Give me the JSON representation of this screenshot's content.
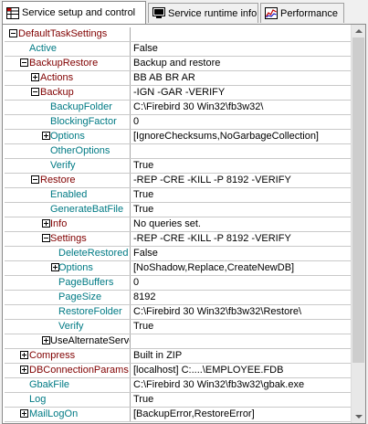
{
  "tabs": [
    {
      "label": "Service setup and control",
      "icon": "settings-grid-icon",
      "active": true
    },
    {
      "label": "Service runtime info",
      "icon": "monitor-icon",
      "active": false
    },
    {
      "label": "Performance",
      "icon": "chart-icon",
      "active": false
    }
  ],
  "rows": [
    {
      "name": "DefaultTaskSettings",
      "value": "",
      "level": 0,
      "expander": "minus",
      "color": "red"
    },
    {
      "name": "Active",
      "value": "False",
      "level": 1,
      "expander": "",
      "color": "teal"
    },
    {
      "name": "BackupRestore",
      "value": "Backup and restore",
      "level": 1,
      "expander": "minus",
      "color": "red"
    },
    {
      "name": "Actions",
      "value": "BB AB BR AR",
      "level": 2,
      "expander": "plus",
      "color": "red"
    },
    {
      "name": "Backup",
      "value": "-IGN -GAR -VERIFY",
      "level": 2,
      "expander": "minus",
      "color": "red"
    },
    {
      "name": "BackupFolder",
      "value": "C:\\Firebird 30 Win32\\fb3w32\\",
      "level": 3,
      "expander": "",
      "color": "teal"
    },
    {
      "name": "BlockingFactor",
      "value": "0",
      "level": 3,
      "expander": "",
      "color": "teal"
    },
    {
      "name": "Options",
      "value": "[IgnoreChecksums,NoGarbageCollection]",
      "level": 3,
      "expander": "plus",
      "color": "teal"
    },
    {
      "name": "OtherOptions",
      "value": "",
      "level": 3,
      "expander": "",
      "color": "teal"
    },
    {
      "name": "Verify",
      "value": "True",
      "level": 3,
      "expander": "",
      "color": "teal"
    },
    {
      "name": "Restore",
      "value": "-REP -CRE -KILL -P 8192 -VERIFY",
      "level": 2,
      "expander": "minus",
      "color": "red"
    },
    {
      "name": "Enabled",
      "value": "True",
      "level": 3,
      "expander": "",
      "color": "teal"
    },
    {
      "name": "GenerateBatFile",
      "value": "True",
      "level": 3,
      "expander": "",
      "color": "teal"
    },
    {
      "name": "Info",
      "value": "No queries set.",
      "level": 3,
      "expander": "plus",
      "color": "red"
    },
    {
      "name": "Settings",
      "value": "-REP -CRE -KILL -P 8192 -VERIFY",
      "level": 3,
      "expander": "minus",
      "color": "red"
    },
    {
      "name": "DeleteRestored",
      "value": "False",
      "level": 4,
      "expander": "",
      "color": "teal"
    },
    {
      "name": "Options",
      "value": "[NoShadow,Replace,CreateNewDB]",
      "level": 4,
      "expander": "plus",
      "color": "teal"
    },
    {
      "name": "PageBuffers",
      "value": "0",
      "level": 4,
      "expander": "",
      "color": "teal"
    },
    {
      "name": "PageSize",
      "value": "8192",
      "level": 4,
      "expander": "",
      "color": "teal"
    },
    {
      "name": "RestoreFolder",
      "value": "C:\\Firebird 30 Win32\\fb3w32\\Restore\\",
      "level": 4,
      "expander": "",
      "color": "teal"
    },
    {
      "name": "Verify",
      "value": "True",
      "level": 4,
      "expander": "",
      "color": "teal"
    },
    {
      "name": "UseAlternateServe",
      "value": "",
      "level": 3,
      "expander": "plus",
      "color": "default"
    },
    {
      "name": "Compress",
      "value": "Built in ZIP",
      "level": 1,
      "expander": "plus",
      "color": "red"
    },
    {
      "name": "DBConnectionParams",
      "value": "[localhost] C:....\\EMPLOYEE.FDB",
      "level": 1,
      "expander": "plus",
      "color": "red"
    },
    {
      "name": "GbakFile",
      "value": "C:\\Firebird 30 Win32\\fb3w32\\gbak.exe",
      "level": 1,
      "expander": "",
      "color": "teal"
    },
    {
      "name": "Log",
      "value": "True",
      "level": 1,
      "expander": "",
      "color": "teal"
    },
    {
      "name": "MailLogOn",
      "value": "[BackupError,RestoreError]",
      "level": 1,
      "expander": "plus",
      "color": "teal"
    }
  ],
  "colors": {
    "red": "#800000",
    "teal": "#007a84",
    "default": "#000000"
  }
}
